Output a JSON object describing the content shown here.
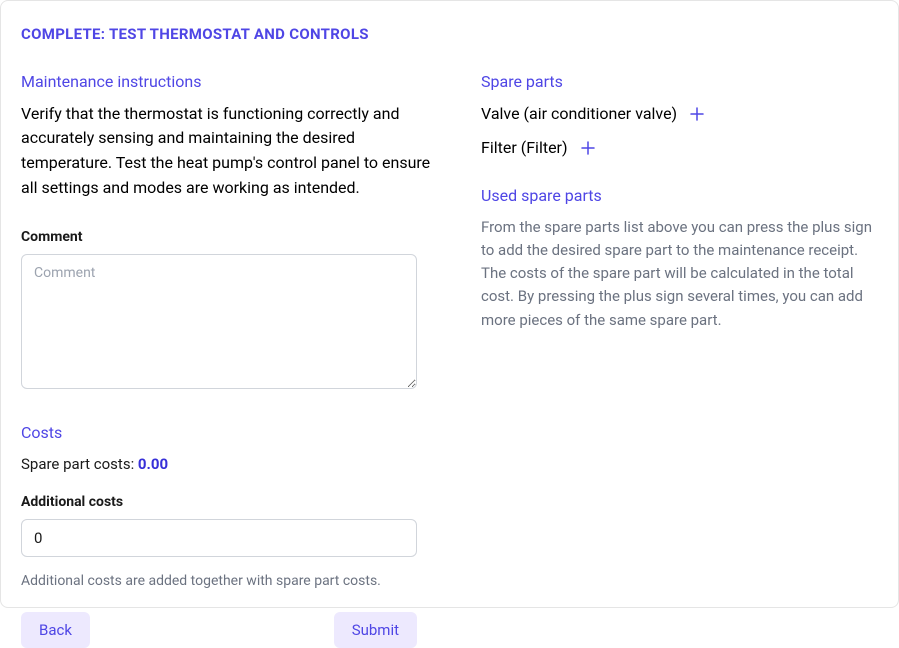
{
  "page_title": "COMPLETE: TEST THERMOSTAT AND CONTROLS",
  "left": {
    "instructions_heading": "Maintenance instructions",
    "instructions_text": "Verify that the thermostat is functioning correctly and accurately sensing and maintaining the desired temperature. Test the heat pump's control panel to ensure all settings and modes are working as intended.",
    "comment_label": "Comment",
    "comment_placeholder": "Comment",
    "comment_value": "",
    "costs_heading": "Costs",
    "spare_cost_label": "Spare part costs: ",
    "spare_cost_value": "0.00",
    "additional_costs_label": "Additional costs",
    "additional_costs_value": "0",
    "additional_costs_help": "Additional costs are added together with spare part costs.",
    "back_button": "Back",
    "submit_button": "Submit"
  },
  "right": {
    "spare_parts_heading": "Spare parts",
    "spare_parts": [
      {
        "label": "Valve (air conditioner valve)"
      },
      {
        "label": "Filter (Filter)"
      }
    ],
    "used_parts_heading": "Used spare parts",
    "used_parts_desc": "From the spare parts list above you can press the plus sign to add the desired spare part to the maintenance receipt. The costs of the spare part will be calculated in the total cost. By pressing the plus sign several times, you can add more pieces of the same spare part."
  }
}
